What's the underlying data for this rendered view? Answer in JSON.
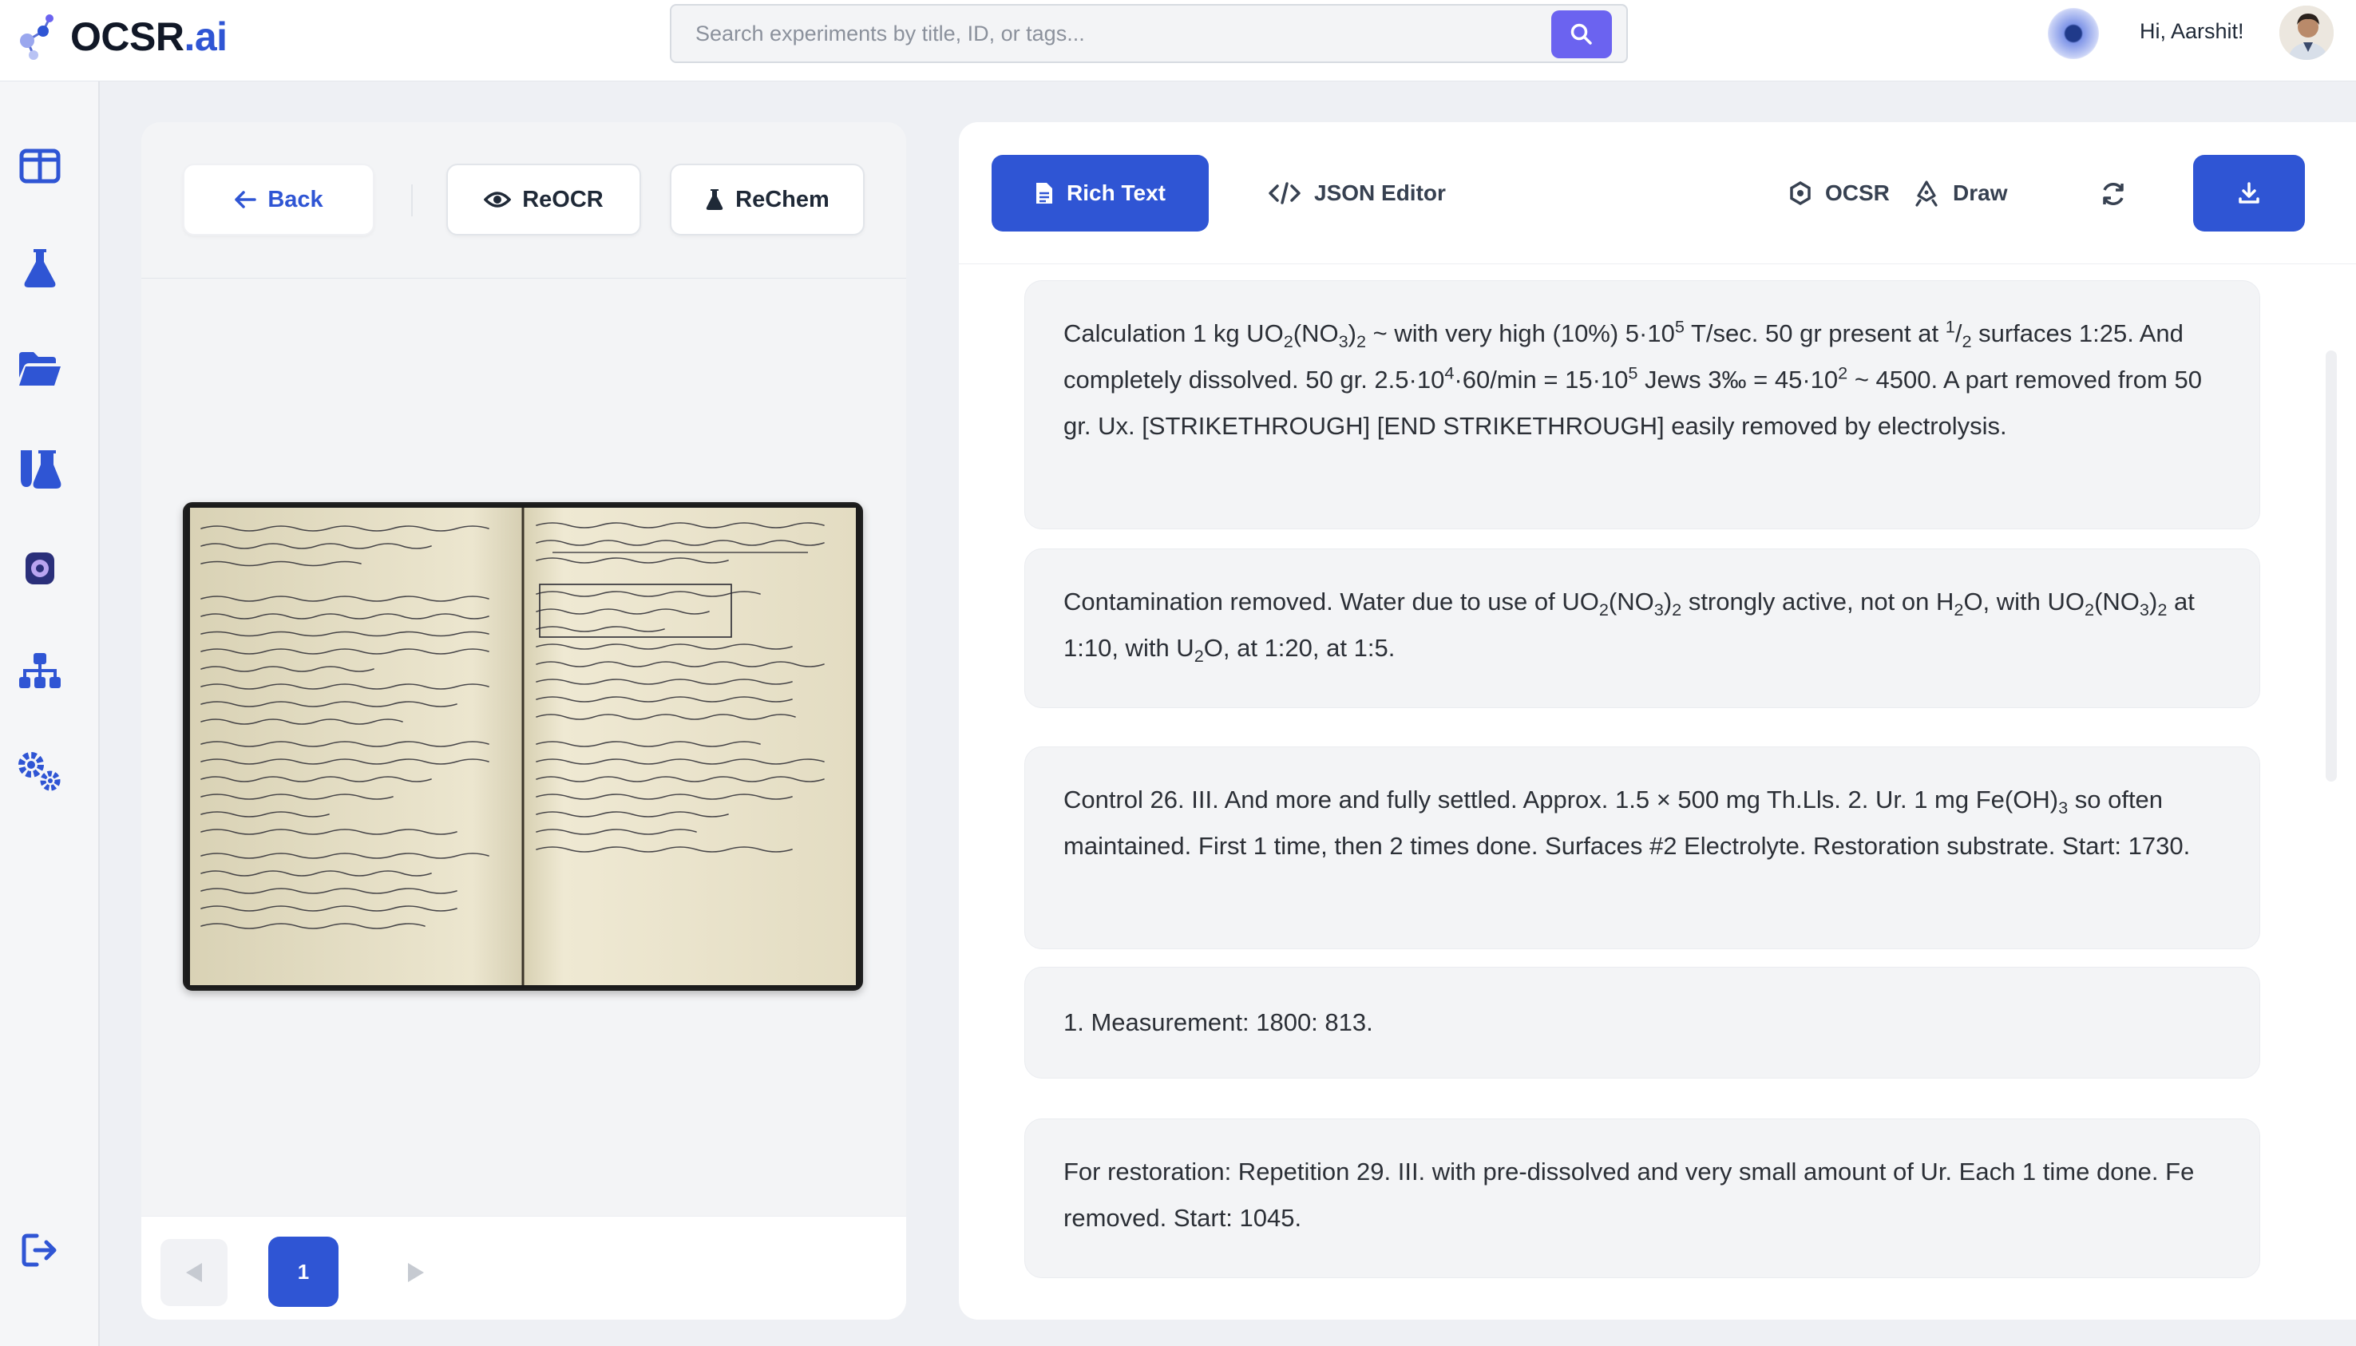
{
  "app": {
    "logo_text": "OCSR",
    "logo_suffix": ".ai"
  },
  "search": {
    "placeholder": "Search experiments by title, ID, or tags..."
  },
  "user": {
    "greeting": "Hi, Aarshit!"
  },
  "sidebar": {
    "items": [
      {
        "icon": "dashboard-icon"
      },
      {
        "icon": "flask-icon"
      },
      {
        "icon": "folder-open-icon"
      },
      {
        "icon": "test-tubes-icon"
      },
      {
        "icon": "orb-icon"
      },
      {
        "icon": "hierarchy-icon"
      },
      {
        "icon": "settings-gears-icon"
      },
      {
        "icon": "logout-icon"
      }
    ]
  },
  "left_toolbar": {
    "back_label": "Back",
    "reocr_label": "ReOCR",
    "rechem_label": "ReChem"
  },
  "pagination": {
    "current_page": "1"
  },
  "tabs": {
    "rich_text": "Rich Text",
    "json_editor": "JSON Editor",
    "ocsr": "OCSR",
    "draw": "Draw"
  },
  "colors": {
    "accent": "#2f55d4",
    "search_button": "#6b63f0"
  },
  "content": {
    "card1": {
      "t1": "Calculation 1 kg UO",
      "t2": "(NO",
      "t3": ")",
      "t4": " ~ with very high (10%) 5·10",
      "t5": " T/sec. 50 gr present at ",
      "t6": "/",
      "t7": " surfaces 1:25. And completely dissolved. 50 gr. 2.5·10",
      "t8": "·60/min = 15·10",
      "t9": " Jews 3‰ = 45·10",
      "t10": " ~ 4500. A part removed from 50 gr. Ux. [STRIKETHROUGH] [END STRIKETHROUGH] easily removed by electrolysis.",
      "s2": "2",
      "s3": "3",
      "s2b": "2",
      "p5": "5",
      "p1": "1",
      "s2c": "2",
      "p4": "4",
      "p5b": "5",
      "p2": "2"
    },
    "card2": {
      "t1": "Contamination removed. Water due to use of UO",
      "t2": "(NO",
      "t3": ")",
      "t4": " strongly active, not on H",
      "t5": "O, with UO",
      "t6": "(NO",
      "t7": ")",
      "t8": " at 1:10, with U",
      "t9": "O, at 1:20, at 1:5.",
      "s2": "2",
      "s3": "3",
      "s2b": "2",
      "s2c": "2",
      "s2d": "2",
      "s3b": "3",
      "s2e": "2",
      "s2f": "2"
    },
    "card3": {
      "t1": "Control 26. III. And more and fully settled. Approx. 1.5 × 500 mg Th.Lls. 2. Ur. 1 mg Fe(OH)",
      "t2": " so often maintained. First 1 time, then 2 times done. Surfaces #2 Electrolyte. Restoration substrate. Start: 1730.",
      "s3": "3"
    },
    "card4": "1. Measurement: 1800: 813.",
    "card5": "For restoration: Repetition 29. III. with pre-dissolved and very small amount of Ur. Each 1 time done. Fe removed. Start: 1045."
  }
}
